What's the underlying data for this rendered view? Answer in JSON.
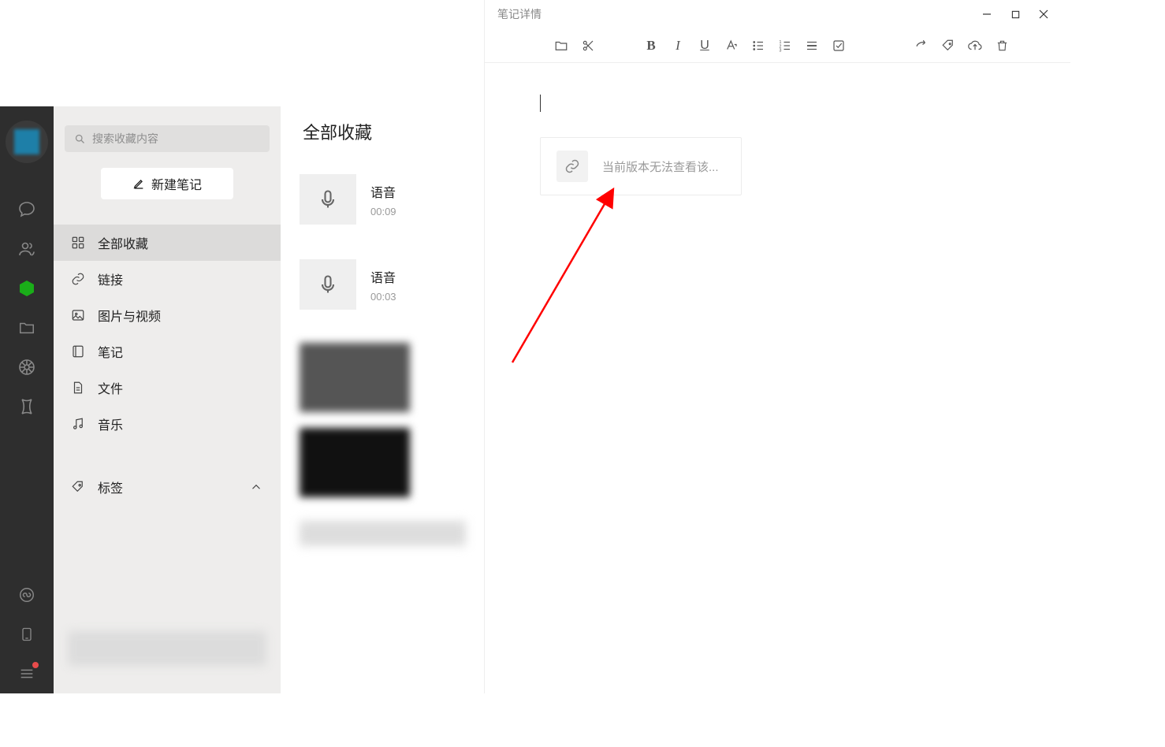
{
  "sidebar": {
    "search_placeholder": "搜索收藏内容",
    "new_note_label": "新建笔记",
    "categories": [
      {
        "label": "全部收藏",
        "icon": "grid",
        "selected": true
      },
      {
        "label": "链接",
        "icon": "link",
        "selected": false
      },
      {
        "label": "图片与视频",
        "icon": "image",
        "selected": false
      },
      {
        "label": "笔记",
        "icon": "note",
        "selected": false
      },
      {
        "label": "文件",
        "icon": "file",
        "selected": false
      },
      {
        "label": "音乐",
        "icon": "music",
        "selected": false
      }
    ],
    "tags_label": "标签"
  },
  "list": {
    "header": "全部收藏",
    "items": [
      {
        "type": "voice",
        "title": "语音",
        "duration": "00:09"
      },
      {
        "type": "voice",
        "title": "语音",
        "duration": "00:03"
      }
    ]
  },
  "note": {
    "window_title": "笔记详情",
    "link_card_text": "当前版本无法查看该..."
  }
}
